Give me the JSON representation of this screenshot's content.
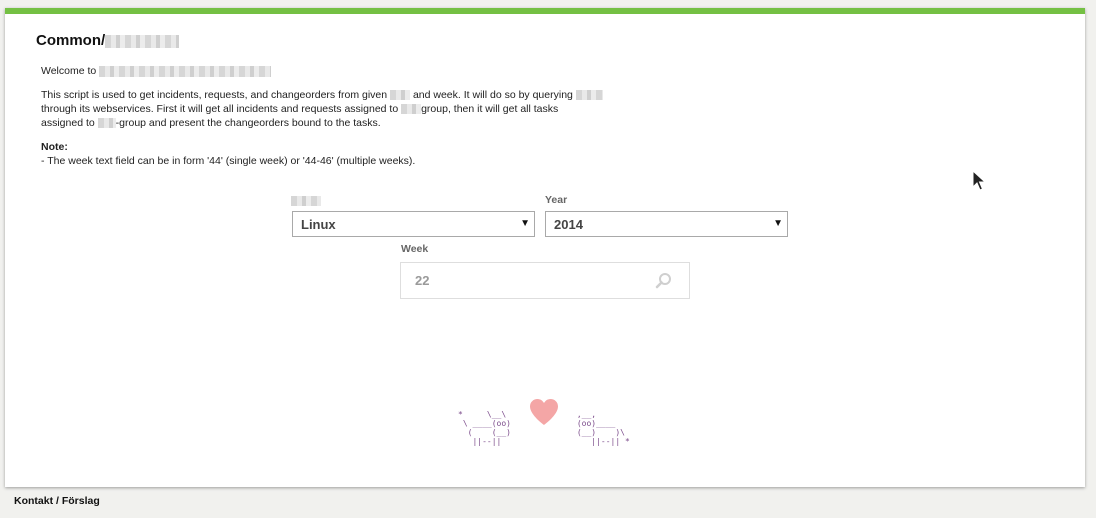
{
  "header": {
    "title": "Common/"
  },
  "intro": {
    "welcome": "Welcome to",
    "desc_1": "This script is used to get incidents, requests, and changeorders from given",
    "desc_2": "and week. It will do so by querying",
    "desc_3": "through its webservices. First it will get all incidents and requests assigned to",
    "desc_4": "group, then it will get all tasks",
    "desc_5": "assigned to",
    "desc_6": "-group and present the changeorders bound to the tasks.",
    "note_title": "Note:",
    "note_text": "- The week text field can be in form '44' (single week) or '44-46' (multiple weeks)."
  },
  "form": {
    "group_value": "Linux",
    "year_label": "Year",
    "year_value": "2014",
    "week_label": "Week",
    "week_value": "22"
  },
  "ascii": {
    "left": "*     \\__\\\n \\ ____(oo)\n  (    (__)\n   ||--||",
    "right": " ,__,\n (oo)____\n (__)    )\\\n    ||--|| *"
  },
  "footer": {
    "link": "Kontakt / Förslag"
  },
  "colors": {
    "accent": "#74c043",
    "heart": "#f4a6a6",
    "ascii": "#7a4a8a"
  }
}
